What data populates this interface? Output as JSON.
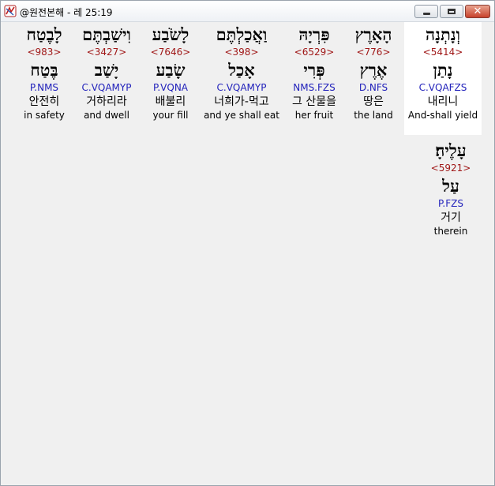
{
  "window": {
    "title": "@원전본해 - 레 25:19",
    "close_glyph": "✕"
  },
  "words": [
    {
      "hebrew": "וְנָתְנָה",
      "strong": "<5414>",
      "lemma": "נָתַן",
      "morph": "C.VQAFZS",
      "korean": "내리니",
      "english": "And-shall yield"
    },
    {
      "hebrew": "הָאָרֶץ",
      "strong": "<776>",
      "lemma": "אֶרֶץ",
      "morph": "D.NFS",
      "korean": "땅은",
      "english": "the land"
    },
    {
      "hebrew": "פִּרְיָהּ",
      "strong": "<6529>",
      "lemma": "פְּרִי",
      "morph": "NMS.FZS",
      "korean": "그 산물을",
      "english": "her fruit"
    },
    {
      "hebrew": "וַאֲכַלְתֶּם",
      "strong": "<398>",
      "lemma": "אָכַל",
      "morph": "C.VQAMYP",
      "korean": "너희가-먹고",
      "english": "and ye shall eat"
    },
    {
      "hebrew": "לָשֹׂבַע",
      "strong": "<7646>",
      "lemma": "שָׂבַע",
      "morph": "P.VQNA",
      "korean": "배불리",
      "english": "your fill"
    },
    {
      "hebrew": "וִישַׁבְתֶּם",
      "strong": "<3427>",
      "lemma": "יָשַׁב",
      "morph": "C.VQAMYP",
      "korean": "거하리라",
      "english": "and dwell"
    },
    {
      "hebrew": "לָבֶטַח",
      "strong": "<983>",
      "lemma": "בֶּטַח",
      "morph": "P.NMS",
      "korean": "안전히",
      "english": "in safety"
    },
    {
      "hebrew": "עָלֶיהָ׃",
      "strong": "<5921>",
      "lemma": "עַל",
      "morph": "P.FZS",
      "korean": "거기",
      "english": "therein"
    }
  ]
}
